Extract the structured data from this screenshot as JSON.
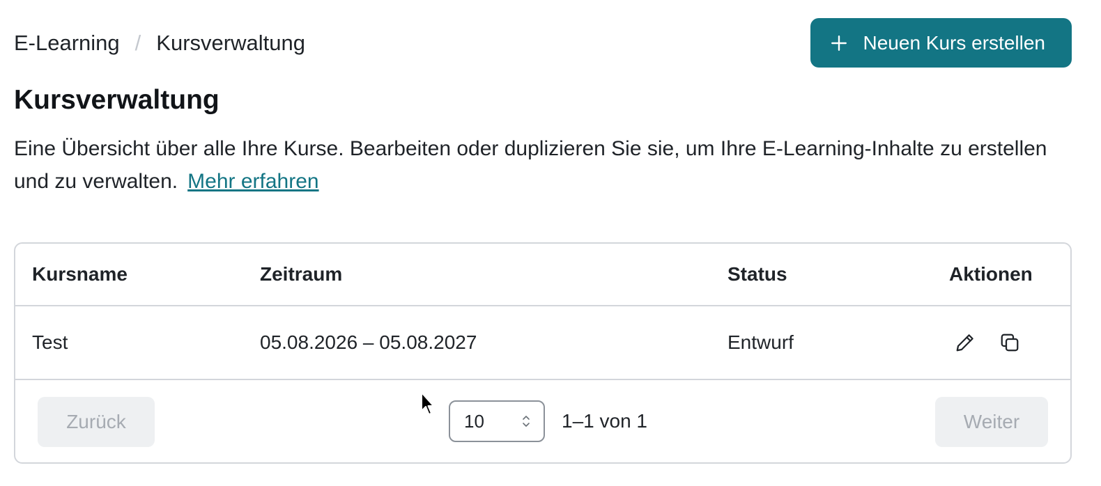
{
  "breadcrumb": {
    "root": "E-Learning",
    "separator": "/",
    "current": "Kursverwaltung"
  },
  "header": {
    "create_label": "Neuen Kurs erstellen",
    "create_icon": "plus-icon"
  },
  "page": {
    "title": "Kursverwaltung",
    "intro": "Eine Übersicht über alle Ihre Kurse. Bearbeiten oder duplizieren Sie sie, um Ihre E-Learning-Inhalte zu erstellen und zu verwalten.",
    "learn_more": "Mehr erfahren"
  },
  "table": {
    "columns": [
      "Kursname",
      "Zeitraum",
      "Status",
      "Aktionen"
    ],
    "rows": [
      {
        "name": "Test",
        "period": "05.08.2026 – 05.08.2027",
        "status": "Entwurf",
        "actions": [
          "pencil-icon",
          "copy-icon"
        ]
      }
    ]
  },
  "pagination": {
    "back_label": "Zurück",
    "next_label": "Weiter",
    "page_size": "10",
    "range_text": "1–1 von 1"
  },
  "colors": {
    "accent": "#137584",
    "border": "#d3d6db",
    "disabled_bg": "#eef0f2",
    "disabled_text": "#a6abb2"
  }
}
